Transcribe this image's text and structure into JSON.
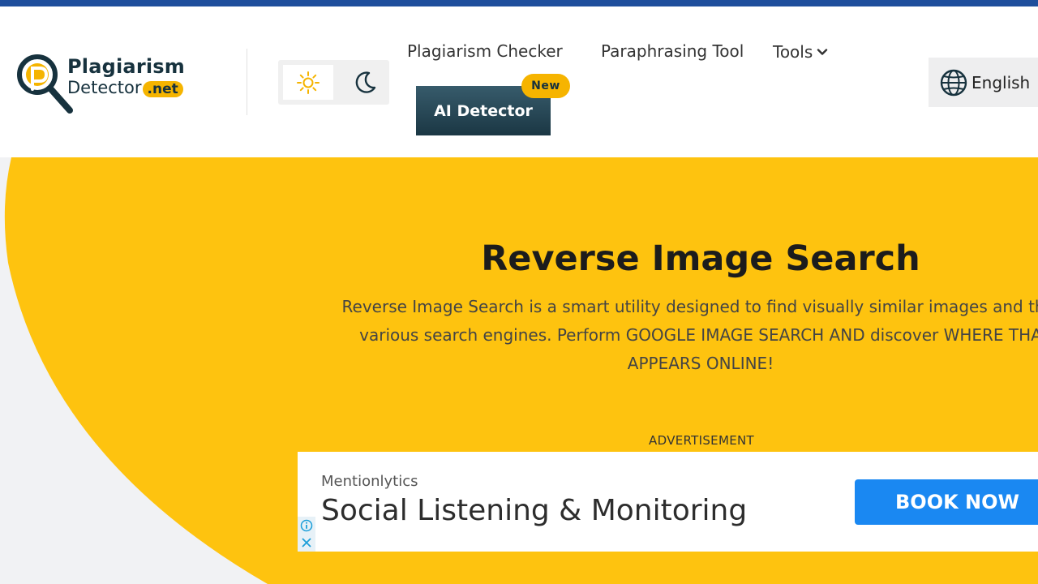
{
  "colors": {
    "top_strip": "#1f4e9c",
    "hero_yellow": "#fec30f",
    "ai_button": "#2b4a58",
    "badge_yellow": "#f6b400",
    "cta_blue": "#1a88f2"
  },
  "logo": {
    "line1": "Plagiarism",
    "line2": "Detector",
    "suffix": ".net",
    "icon": "magnifier-p-logo-icon"
  },
  "theme_toggle": {
    "light_icon": "sun-icon",
    "dark_icon": "moon-icon"
  },
  "nav": {
    "plagiarism_checker": "Plagiarism Checker",
    "paraphrasing_tool": "Paraphrasing Tool",
    "tools": "Tools",
    "tools_icon": "chevron-down-icon",
    "ai_detector": "AI Detector",
    "new_badge": "New"
  },
  "language": {
    "label": "English",
    "icon": "globe-icon"
  },
  "hero": {
    "title": "Reverse Image Search",
    "description_lines": [
      "Reverse Image Search is a smart utility designed to find visually similar images and thei",
      "various search engines. Perform GOOGLE IMAGE SEARCH AND discover WHERE THA",
      "APPEARS ONLINE!"
    ]
  },
  "ad": {
    "label": "ADVERTISEMENT",
    "brand": "Mentionlytics",
    "headline": "Social Listening & Monitoring",
    "cta": "BOOK NOW",
    "info_icon": "info-icon",
    "close_icon": "close-icon"
  }
}
